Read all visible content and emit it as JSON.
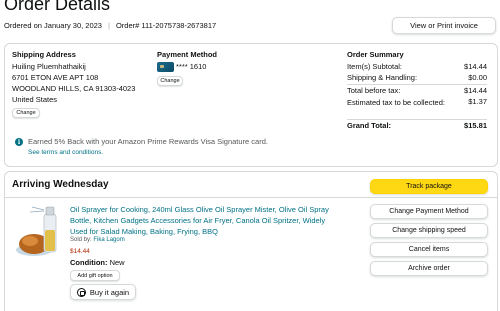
{
  "header": {
    "title": "Order Details",
    "ordered_on": "Ordered on January 30, 2023",
    "order_number": "Order# 111-2075738-2673817",
    "invoice_button": "View or Print invoice"
  },
  "shipping_address": {
    "title": "Shipping Address",
    "lines": [
      "Huiling Pluemhathaikij",
      "6701 ETON AVE APT 108",
      "WOODLAND HILLS, CA 91303-4023",
      "United States"
    ],
    "change_button": "Change"
  },
  "payment_method": {
    "title": "Payment Method",
    "card": "**** 1610",
    "change_button": "Change"
  },
  "order_summary": {
    "title": "Order Summary",
    "rows": [
      {
        "label": "Item(s) Subtotal:",
        "value": "$14.44"
      },
      {
        "label": "Shipping & Handling:",
        "value": "$0.00"
      },
      {
        "label": "Total before tax:",
        "value": "$14.44"
      },
      {
        "label": "Estimated tax to be collected:",
        "value": "$1.37"
      }
    ],
    "grand_total_label": "Grand Total:",
    "grand_total_value": "$15.81"
  },
  "promo": {
    "text": "Earned 5% Back with your Amazon Prime Rewards Visa Signature card.",
    "link": "See terms and conditions."
  },
  "shipment": {
    "arriving": "Arriving Wednesday",
    "product_title": "Oil Sprayer for Cooking, 240ml Glass Olive Oil Sprayer Mister, Olive Oil Spray Bottle, Kitchen Gadgets Accessories for Air Fryer, Canola Oil Spritzer, Widely Used for Salad Making, Baking, Frying, BBQ",
    "sold_by_label": "Sold by: ",
    "sold_by": "Fika Lagom",
    "price": "$14.44",
    "condition_label": "Condition:",
    "condition_value": "New",
    "gift_option": "Add gift option",
    "buy_again": "Buy it again"
  },
  "actions": {
    "track": "Track package",
    "change_payment": "Change Payment Method",
    "change_speed": "Change shipping speed",
    "cancel": "Cancel items",
    "archive": "Archive order"
  },
  "colors": {
    "link": "#007185",
    "price": "#b12704",
    "track_button": "#ffd814"
  }
}
